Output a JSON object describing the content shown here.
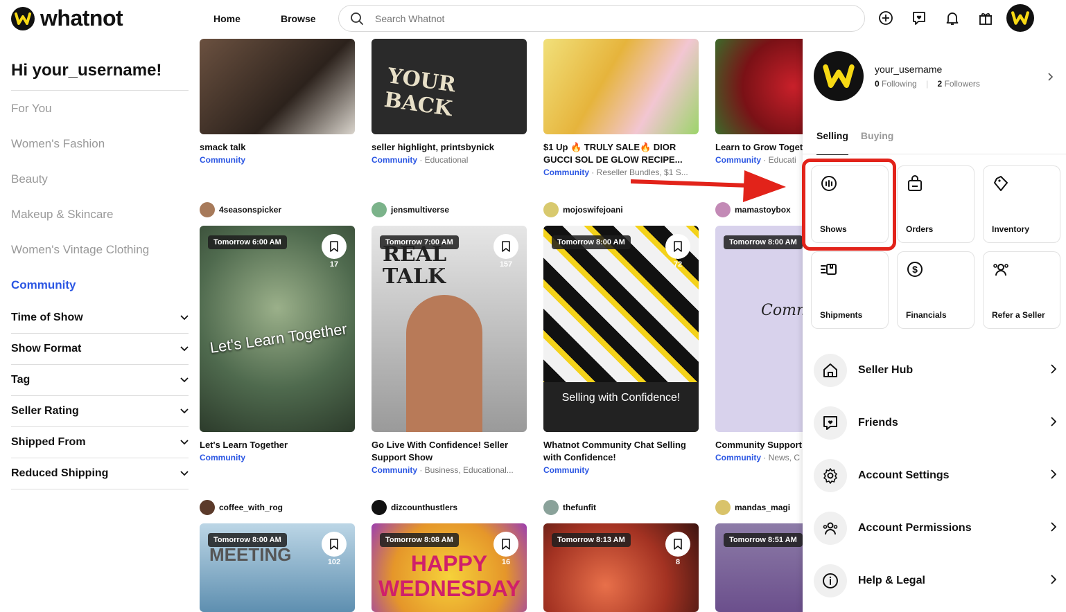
{
  "topbar": {
    "logo_text": "whatnot",
    "nav": [
      "Home",
      "Browse"
    ],
    "search_placeholder": "Search Whatnot"
  },
  "sidebar": {
    "greeting": "Hi your_username!",
    "categories": [
      "For You",
      "Women's Fashion",
      "Beauty",
      "Makeup & Skincare",
      "Women's Vintage Clothing",
      "Community"
    ],
    "active_category": "Community",
    "filters": [
      "Time of Show",
      "Show Format",
      "Tag",
      "Seller Rating",
      "Shipped From",
      "Reduced Shipping"
    ]
  },
  "row1": [
    {
      "title": "smack talk",
      "category": "Community",
      "tags": ""
    },
    {
      "title": "seller highlight, printsbynick",
      "category": "Community",
      "tags": "Educational"
    },
    {
      "title": "$1 Up 🔥 TRULY SALE🔥 DIOR GUCCI SOL DE GLOW RECIPE...",
      "category": "Community",
      "tags": "Reseller Bundles, $1 S..."
    },
    {
      "title": "Learn to Grow Toget",
      "category": "Community",
      "tags": "Educati"
    }
  ],
  "row2": [
    {
      "seller": "4seasonspicker",
      "time": "Tomorrow 6:00 AM",
      "count": "17",
      "title": "Let's Learn Together",
      "category": "Community",
      "tags": "",
      "overlay": "Let's Learn Together"
    },
    {
      "seller": "jensmultiverse",
      "time": "Tomorrow 7:00 AM",
      "count": "157",
      "title": "Go Live With Confidence! Seller Support Show",
      "category": "Community",
      "tags": "Business, Educational...",
      "overlay": "REAL TALK"
    },
    {
      "seller": "mojoswifejoani",
      "time": "Tomorrow 8:00 AM",
      "count": "72",
      "title": "Whatnot Community Chat Selling with Confidence!",
      "category": "Community",
      "tags": "",
      "overlay": "Selling with Confidence!"
    },
    {
      "seller": "mamastoybox",
      "time": "Tomorrow 8:00 AM",
      "count": "",
      "title": "Community Support",
      "category": "Community",
      "tags": "News, C",
      "overlay": "Commu"
    }
  ],
  "row3": [
    {
      "seller": "coffee_with_rog",
      "time": "Tomorrow 8:00 AM",
      "count": "102",
      "overlay": "MEETING"
    },
    {
      "seller": "dizcounthustlers",
      "time": "Tomorrow 8:08 AM",
      "count": "16",
      "overlay": "HAPPY WEDNESDAY"
    },
    {
      "seller": "thefunfit",
      "time": "Tomorrow 8:13 AM",
      "count": "8",
      "overlay": ""
    },
    {
      "seller": "mandas_magi",
      "time": "Tomorrow 8:51 AM",
      "count": "",
      "overlay": ""
    }
  ],
  "panel": {
    "username": "your_username",
    "following_count": "0",
    "following_label": "Following",
    "followers_count": "2",
    "followers_label": "Followers",
    "tabs": [
      "Selling",
      "Buying"
    ],
    "tiles": [
      "Shows",
      "Orders",
      "Inventory",
      "Shipments",
      "Financials",
      "Refer a Seller"
    ],
    "menu": [
      "Seller Hub",
      "Friends",
      "Account Settings",
      "Account Permissions",
      "Help & Legal"
    ]
  },
  "colors": {
    "accent": "#2b56e3",
    "brand_yellow": "#f7d914",
    "highlight": "#e2231a"
  }
}
